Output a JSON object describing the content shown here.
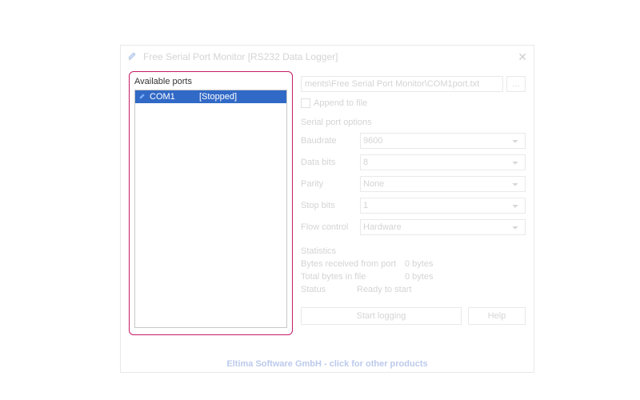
{
  "titlebar": {
    "title": "Free Serial Port Monitor [RS232 Data Logger]"
  },
  "ports_panel": {
    "title": "Available ports",
    "items": [
      {
        "name": "COM1",
        "status": "[Stopped]"
      }
    ]
  },
  "file": {
    "path": "ments\\Free Serial Port Monitor\\COM1port.txt",
    "browse_label": "...",
    "append_label": "Append to file"
  },
  "serial": {
    "section_label": "Serial port options",
    "baudrate_label": "Baudrate",
    "baudrate_value": "9600",
    "databits_label": "Data bits",
    "databits_value": "8",
    "parity_label": "Parity",
    "parity_value": "None",
    "stopbits_label": "Stop bits",
    "stopbits_value": "1",
    "flow_label": "Flow control",
    "flow_value": "Hardware"
  },
  "stats": {
    "section_label": "Statistics",
    "recv_label": "Bytes received from port",
    "recv_value": "0 bytes",
    "total_label": "Total bytes in file",
    "total_value": "0 bytes",
    "status_label": "Status",
    "status_value": "Ready to start"
  },
  "buttons": {
    "start": "Start logging",
    "help": "Help"
  },
  "footer": {
    "link": "Eltima Software GmbH - click for other products"
  }
}
